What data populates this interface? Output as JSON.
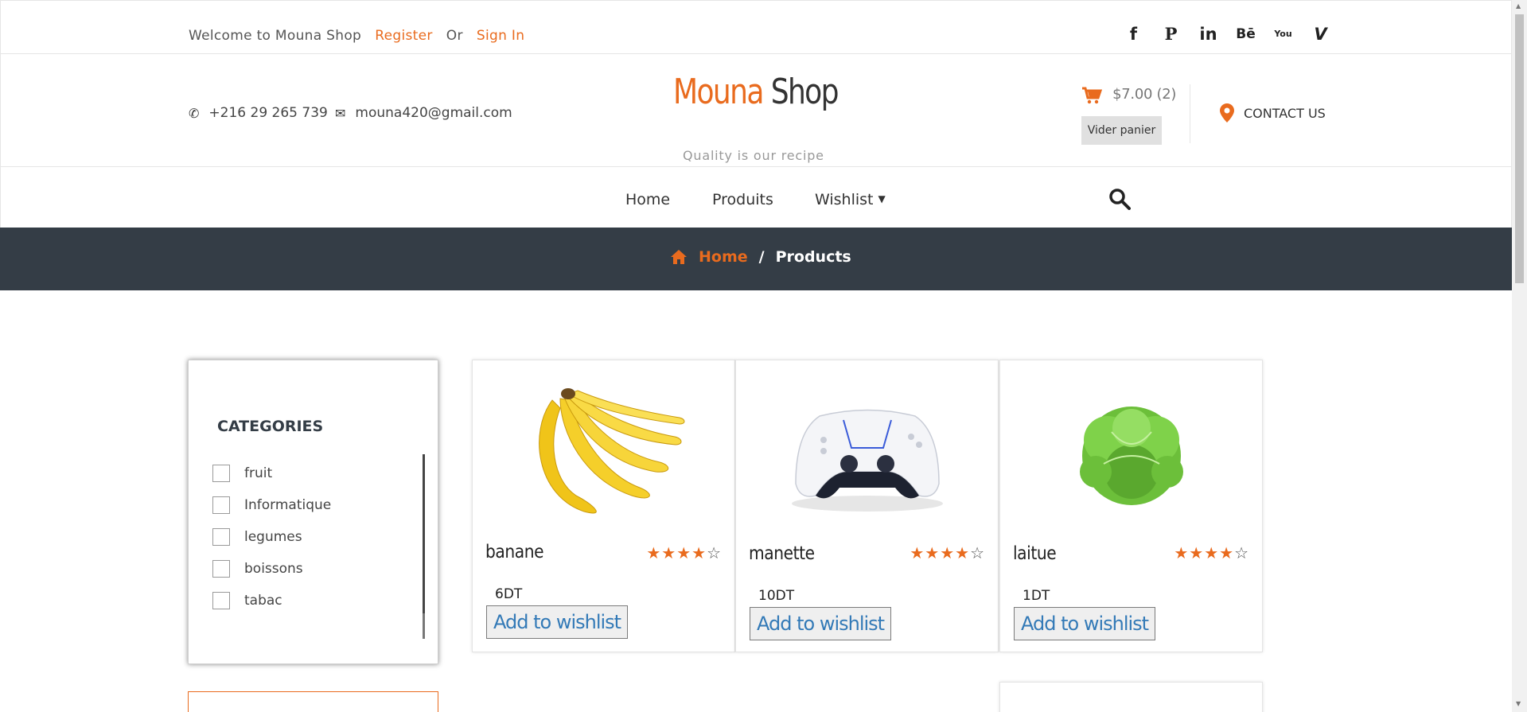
{
  "topbar": {
    "welcome": "Welcome to Mouna Shop",
    "register": "Register",
    "or": "Or",
    "signin": "Sign In",
    "social": [
      "f",
      "P",
      "in",
      "Bē",
      "You",
      "V"
    ],
    "social_icons": [
      "facebook-icon",
      "pinterest-icon",
      "linkedin-icon",
      "behance-icon",
      "youtube-icon",
      "vimeo-icon"
    ]
  },
  "header": {
    "phone": "+216 29 265 739",
    "email": "mouna420@gmail.com",
    "logo_first": "Mouna",
    "logo_second": "Shop",
    "tagline": "Quality is our recipe",
    "cart_total": "$7.00 (2)",
    "clear_cart": "Vider panier",
    "contact": "CONTACT US"
  },
  "nav": {
    "home": "Home",
    "produits": "Produits",
    "wishlist": "Wishlist"
  },
  "breadcrumb": {
    "home": "Home",
    "separator": "/",
    "current": "Products"
  },
  "sidebar": {
    "title": "CATEGORIES",
    "categories": [
      "fruit",
      "Informatique",
      "legumes",
      "boissons",
      "tabac"
    ]
  },
  "products": [
    {
      "name": "banane",
      "price": "6DT",
      "rating": 4,
      "max_rating": 5,
      "button": "Add to wishlist"
    },
    {
      "name": "manette",
      "price": "10DT",
      "rating": 4,
      "max_rating": 5,
      "button": "Add to wishlist"
    },
    {
      "name": "laitue",
      "price": "1DT",
      "rating": 4,
      "max_rating": 5,
      "button": "Add to wishlist"
    }
  ],
  "colors": {
    "accent": "#e96b1e",
    "dark_bar": "#343d46",
    "link_blue": "#337ab7"
  }
}
